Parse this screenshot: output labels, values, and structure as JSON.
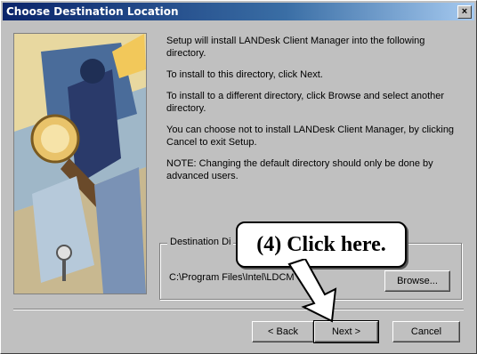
{
  "window": {
    "title": "Choose Destination Location",
    "close_label": "×"
  },
  "body": {
    "paragraphs": [
      "Setup will install LANDesk Client Manager into the following directory.",
      "To install to this directory, click Next.",
      "To install to a different directory, click Browse and select another directory.",
      "You can choose not to install LANDesk Client Manager, by clicking Cancel to exit Setup.",
      "NOTE:  Changing the default directory should only be done by advanced users."
    ]
  },
  "destination": {
    "group_label": "Destination Di",
    "path": "C:\\Program Files\\Intel\\LDCM",
    "browse_label": "Browse..."
  },
  "buttons": {
    "back": "< Back",
    "next": "Next >",
    "cancel": "Cancel"
  },
  "annotation": {
    "text": "(4)  Click here."
  },
  "colors": {
    "titlebar_start": "#0a246a",
    "titlebar_end": "#a6caf0",
    "dialog_face": "#c0c0c0"
  }
}
